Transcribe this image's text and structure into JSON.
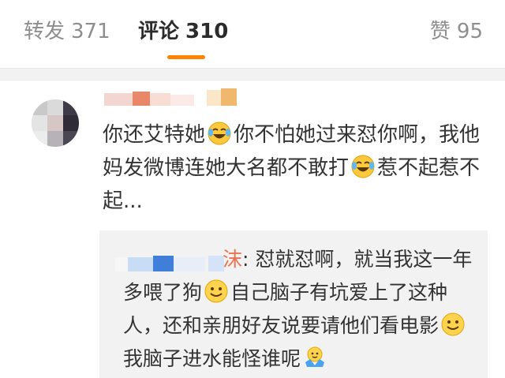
{
  "tabs": {
    "forward": {
      "label": "转发",
      "count": "371"
    },
    "comments": {
      "label": "评论",
      "count": "310"
    },
    "likes": {
      "label": "赞",
      "count": "95"
    }
  },
  "colors": {
    "accent": "#ff8200",
    "username": "#eb7350",
    "text": "#333333",
    "muted": "#8e8e8e",
    "reply_bg": "#f2f2f2"
  },
  "comment": {
    "segments": [
      "你还艾特她",
      "你不怕她过来怼你啊，我他妈发微博连她大名都不敢打",
      "惹不起惹不起..."
    ],
    "emojis": [
      "laugh-cry-emoji",
      "laugh-cry-emoji"
    ]
  },
  "reply": {
    "name_tail": "沫",
    "separator": ": ",
    "segments": [
      "怼就怼啊，就当我这一年多喂了狗",
      "自己脑子有坑爱上了这种人，还和亲朋好友说要请他们看电影",
      "我脑子进水能怪谁呢"
    ],
    "emojis": [
      "smile-emoji",
      "smile-emoji",
      "shrug-emoji"
    ]
  }
}
